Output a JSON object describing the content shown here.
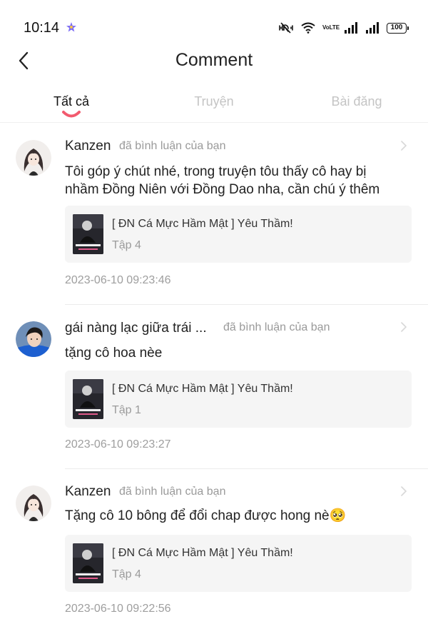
{
  "status": {
    "time": "10:14",
    "volte": "VoLTE",
    "battery": "100"
  },
  "header": {
    "title": "Comment",
    "back_icon": "chevron-left-icon"
  },
  "tabs": [
    {
      "label": "Tất cả",
      "active": true
    },
    {
      "label": "Truyện",
      "active": false
    },
    {
      "label": "Bài đăng",
      "active": false
    }
  ],
  "colors": {
    "accent": "#f25a6e",
    "muted_text": "#9a9a9a",
    "card_bg": "#f5f5f5",
    "inactive_tab": "#c4c4c4"
  },
  "comments": [
    {
      "user": "Kanzen",
      "action": "đã bình luận của bạn",
      "text": "Tôi góp ý chút nhé, trong truyện tôu thấy cô hay bị nhầm Đồng Niên với Đồng Dao nha, cần chú ý thêm",
      "story_title": "[ ĐN Cá Mực Hầm Mật ] Yêu Thầm!",
      "episode": "Tập 4",
      "timestamp": "2023-06-10 09:23:46"
    },
    {
      "user": "gái nàng lạc giữa trái ...",
      "action": "đã bình luận của bạn",
      "text": "tặng cô hoa nèe",
      "story_title": "[ ĐN Cá Mực Hầm Mật ] Yêu Thầm!",
      "episode": "Tập 1",
      "timestamp": "2023-06-10 09:23:27"
    },
    {
      "user": "Kanzen",
      "action": "đã bình luận của bạn",
      "text": "Tặng cô 10 bông để đổi chap được hong nè",
      "emoji": "🥺",
      "story_title": "[ ĐN Cá Mực Hầm Mật ] Yêu Thầm!",
      "episode": "Tập 4",
      "timestamp": "2023-06-10 09:22:56"
    }
  ]
}
